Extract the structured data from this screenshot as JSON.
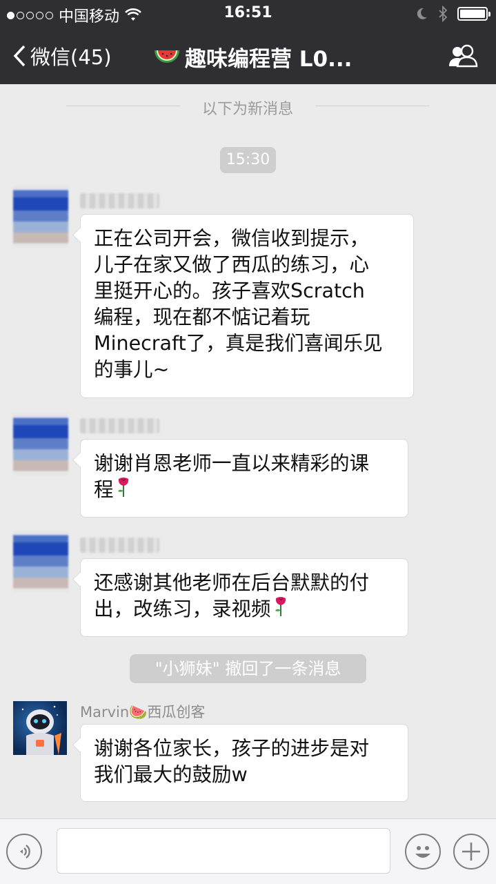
{
  "status_bar": {
    "carrier": "中国移动",
    "time": "16:51"
  },
  "nav": {
    "back_label": "微信(45)",
    "title": "趣味编程营 L0...",
    "title_emoji_icon": "watermelon-icon",
    "members_icon": "group-members-icon"
  },
  "chat": {
    "new_messages_divider": "以下为新消息",
    "timestamp": "15:30",
    "messages": [
      {
        "sender": "",
        "text": "正在公司开会，微信收到提示，\n儿子在家又做了西瓜的练习，心\n里挺开心的。孩子喜欢Scratch\n编程，现在都不惦记着玩\nMinecraft了，真是我们喜闻乐见\n的事儿~",
        "emoji": ""
      },
      {
        "sender": "",
        "text": "谢谢肖恩老师一直以来精彩的课\n程",
        "emoji": "rose-icon"
      },
      {
        "sender": "",
        "text": "还感谢其他老师在后台默默的付\n出，改练习，录视频",
        "emoji": "rose-icon"
      },
      {
        "sender": "Marvin🍉西瓜创客",
        "text": "谢谢各位家长，孩子的进步是对\n我们最大的鼓励w",
        "emoji": ""
      }
    ],
    "recall_notice": "\"小狮妹\" 撤回了一条消息"
  },
  "input_bar": {
    "voice_icon": "voice-icon",
    "emoji_icon": "emoji-face-icon",
    "plus_icon": "plus-icon",
    "text_value": ""
  },
  "colors": {
    "header_bg": "#2e2e33",
    "chat_bg": "#ebebeb",
    "bubble_bg": "#ffffff",
    "system_pill_bg": "#cecece"
  }
}
